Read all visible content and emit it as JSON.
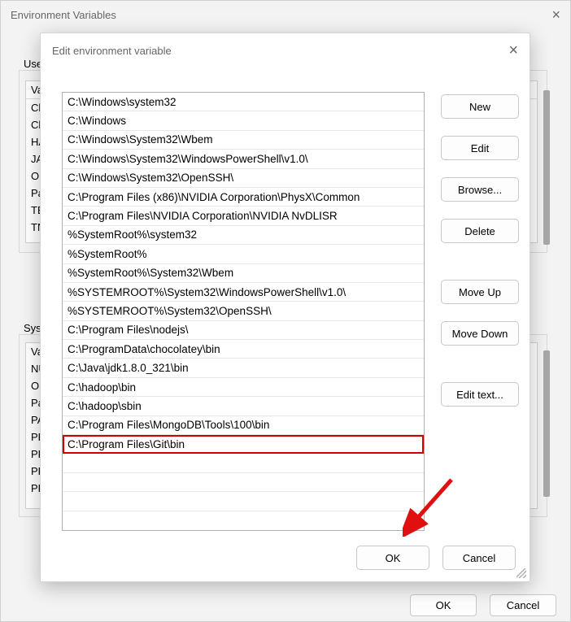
{
  "back_dialog": {
    "title": "Environment Variables",
    "close_label": "×",
    "user_section_label": "User",
    "system_section_label": "Syste",
    "variable_header": "Va",
    "user_rows": [
      "Ch",
      "Ch",
      "HA",
      "JA",
      "On",
      "Pa",
      "TE",
      "TN"
    ],
    "system_rows": [
      "Va",
      "NU",
      "OS",
      "Pa",
      "PA",
      "PR",
      "PR",
      "PR",
      "PR"
    ],
    "ok_label": "OK",
    "cancel_label": "Cancel"
  },
  "front_dialog": {
    "title": "Edit environment variable",
    "close_label": "×",
    "ok_label": "OK",
    "cancel_label": "Cancel",
    "buttons": {
      "new": "New",
      "edit": "Edit",
      "browse": "Browse...",
      "delete": "Delete",
      "move_up": "Move Up",
      "move_down": "Move Down",
      "edit_text": "Edit text..."
    },
    "paths": [
      "C:\\Windows\\system32",
      "C:\\Windows",
      "C:\\Windows\\System32\\Wbem",
      "C:\\Windows\\System32\\WindowsPowerShell\\v1.0\\",
      "C:\\Windows\\System32\\OpenSSH\\",
      "C:\\Program Files (x86)\\NVIDIA Corporation\\PhysX\\Common",
      "C:\\Program Files\\NVIDIA Corporation\\NVIDIA NvDLISR",
      "%SystemRoot%\\system32",
      "%SystemRoot%",
      "%SystemRoot%\\System32\\Wbem",
      "%SYSTEMROOT%\\System32\\WindowsPowerShell\\v1.0\\",
      "%SYSTEMROOT%\\System32\\OpenSSH\\",
      "C:\\Program Files\\nodejs\\",
      "C:\\ProgramData\\chocolatey\\bin",
      "C:\\Java\\jdk1.8.0_321\\bin",
      "C:\\hadoop\\bin",
      "C:\\hadoop\\sbin",
      "C:\\Program Files\\MongoDB\\Tools\\100\\bin",
      "C:\\Program Files\\Git\\bin"
    ],
    "highlight_index": 18
  }
}
